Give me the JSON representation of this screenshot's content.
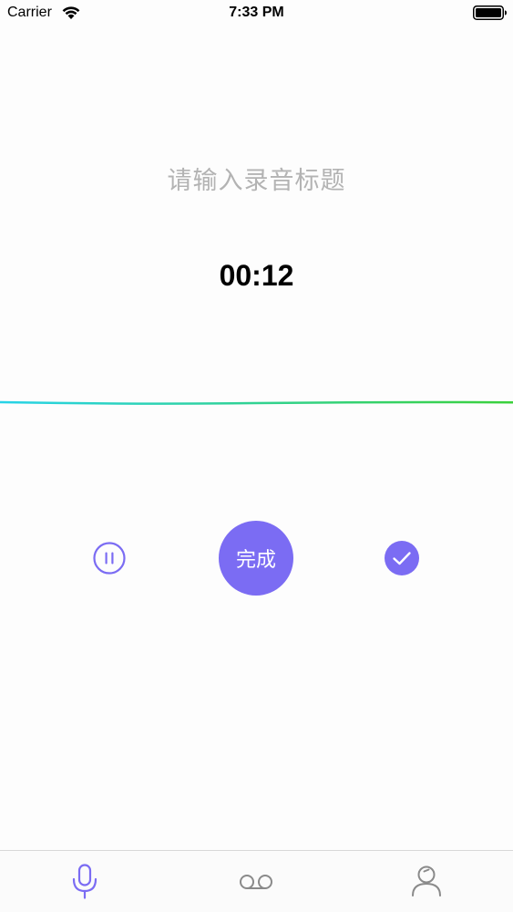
{
  "status_bar": {
    "carrier": "Carrier",
    "time": "7:33 PM"
  },
  "recorder": {
    "title_placeholder": "请输入录音标题",
    "elapsed": "00:12",
    "done_label": "完成"
  },
  "colors": {
    "accent": "#7b6cf3",
    "wave_start": "#27d3e8",
    "wave_end": "#3bd13b",
    "inactive_icon": "#8a8a8a"
  },
  "tabs": [
    {
      "icon": "microphone-icon",
      "active": true
    },
    {
      "icon": "voicemail-icon",
      "active": false
    },
    {
      "icon": "user-icon",
      "active": false
    }
  ]
}
